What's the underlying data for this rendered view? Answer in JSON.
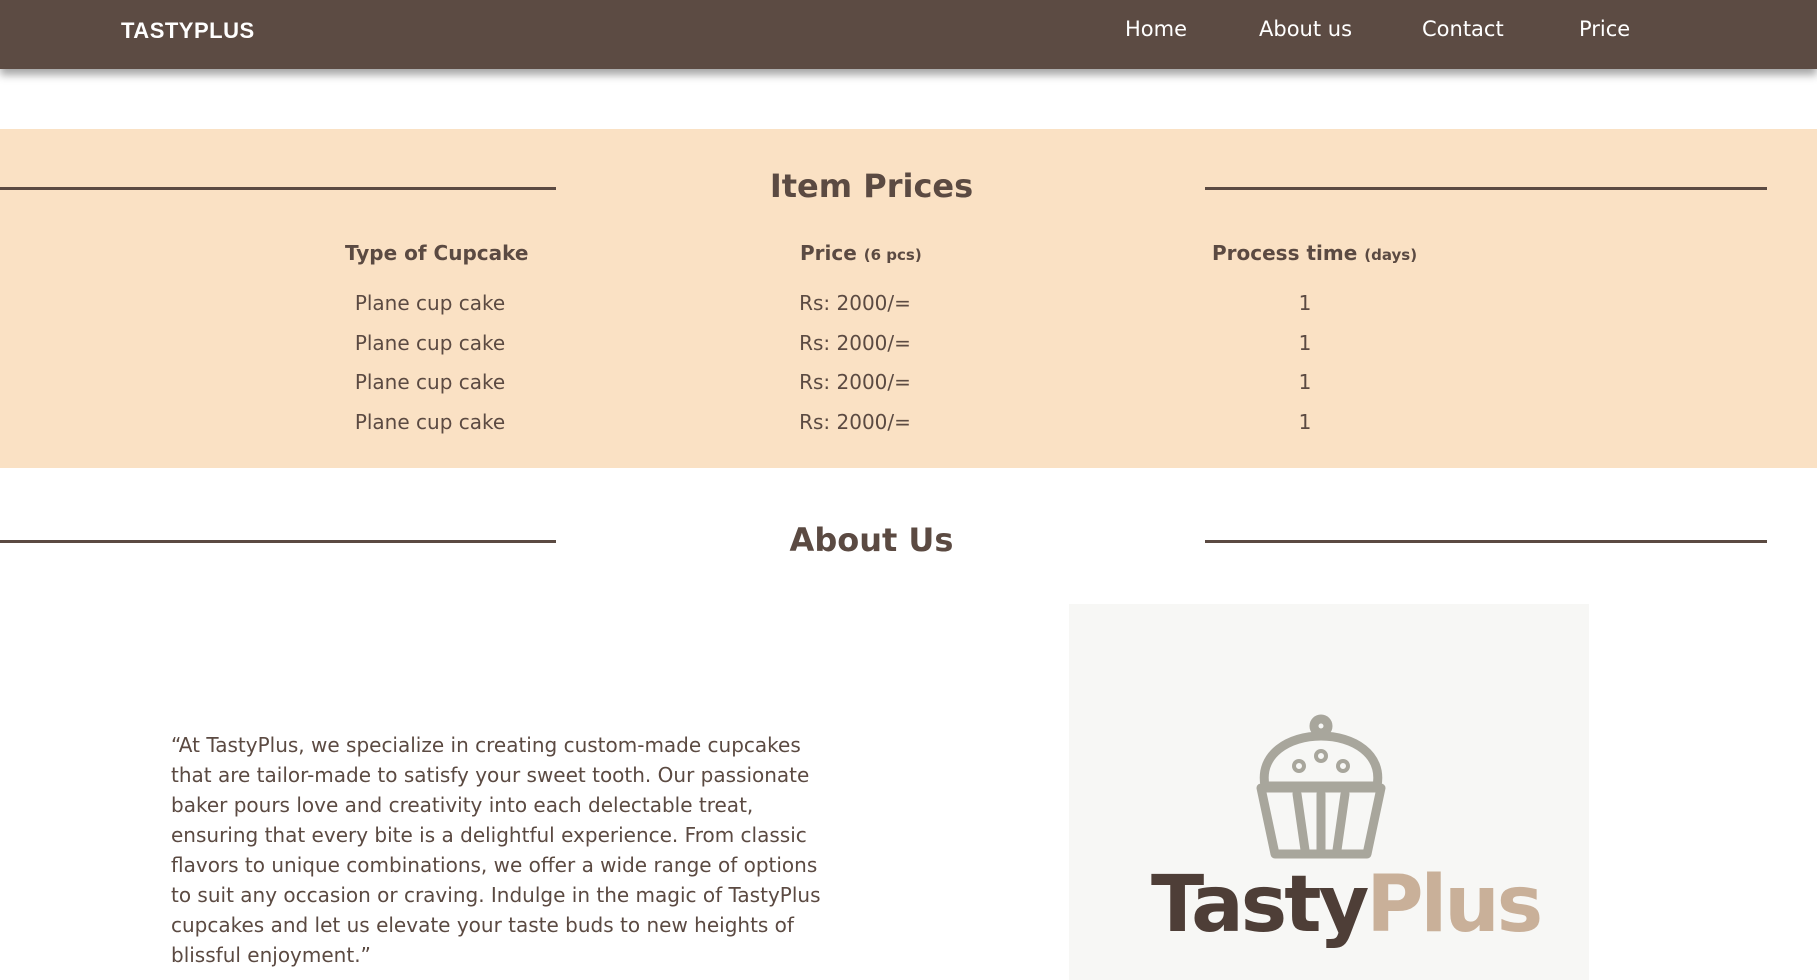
{
  "navbar": {
    "brand": "TASTYPLUS",
    "links": [
      "Home",
      "About us",
      "Contact",
      "Price"
    ]
  },
  "prices": {
    "title": "Item Prices",
    "headers": {
      "type": "Type of Cupcake",
      "price": "Price",
      "price_note": "(6 pcs)",
      "time": "Process time",
      "time_note": "(days)"
    },
    "rows": [
      {
        "type": "Plane cup cake",
        "price": "Rs: 2000/=",
        "time": "1"
      },
      {
        "type": "Plane cup cake",
        "price": "Rs: 2000/=",
        "time": "1"
      },
      {
        "type": "Plane cup cake",
        "price": "Rs: 2000/=",
        "time": "1"
      },
      {
        "type": "Plane cup cake",
        "price": "Rs: 2000/=",
        "time": "1"
      }
    ]
  },
  "about": {
    "title": "About Us",
    "paragraph": "“At TastyPlus, we specialize in creating custom-made cupcakes that are tailor-made to satisfy your sweet tooth. Our passionate baker pours love and creativity into each delectable treat, ensuring that every bite is a delightful experience. From classic flavors to unique combinations, we offer a wide range of options to suit any occasion or craving. Indulge in the magic of TastyPlus cupcakes and let us elevate your taste buds to new heights of blissful enjoyment.”",
    "logo": {
      "part1": "Tasty",
      "part2": "Plus",
      "icon": "cupcake-icon"
    }
  },
  "colors": {
    "nav_bg": "#5c4b43",
    "accent_bg": "#fae1c4",
    "text": "#5b4a42",
    "logo_gray": "#a8a69c",
    "logo_tan": "#c9b099"
  }
}
